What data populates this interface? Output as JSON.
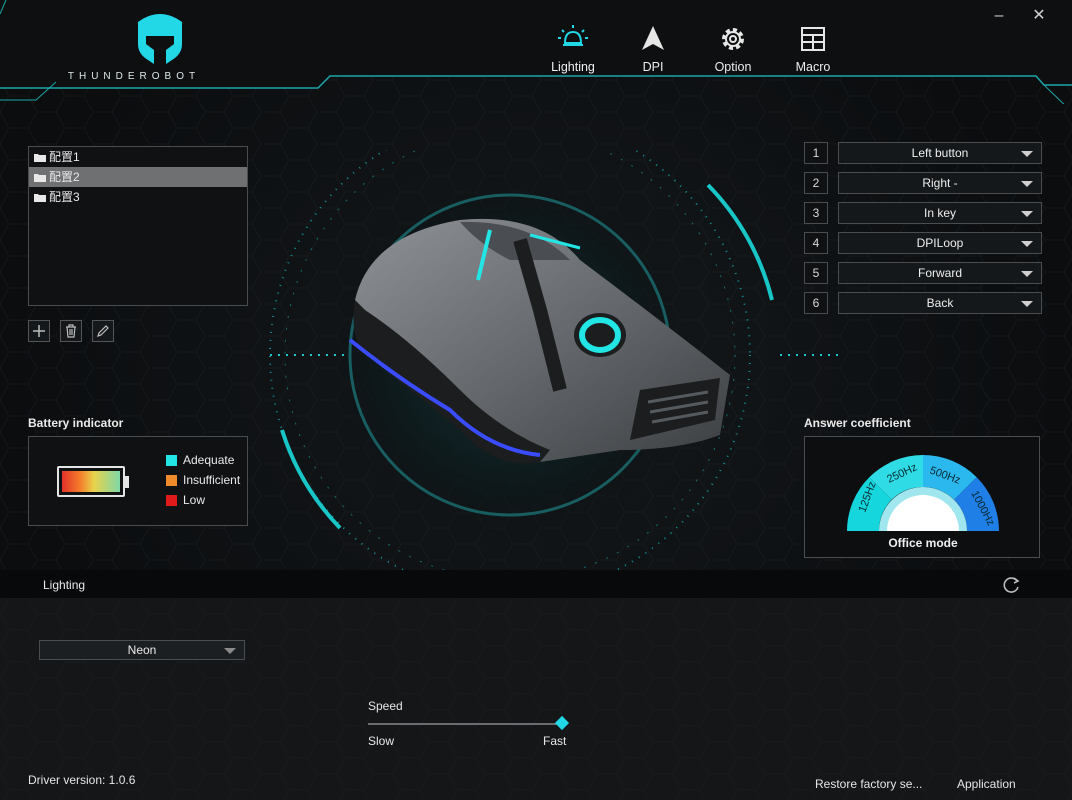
{
  "brand": "THUNDEROBOT",
  "nav": [
    {
      "label": "Lighting",
      "icon": "bulb-icon"
    },
    {
      "label": "DPI",
      "icon": "arrow-icon"
    },
    {
      "label": "Option",
      "icon": "gear-icon"
    },
    {
      "label": "Macro",
      "icon": "grid-icon"
    }
  ],
  "window": {
    "minimize": "–",
    "close": "✕"
  },
  "profiles": {
    "items": [
      "配置1",
      "配置2",
      "配置3"
    ],
    "selected": "配置2"
  },
  "battery": {
    "title": "Battery indicator",
    "legend": [
      {
        "label": "Adequate",
        "color": "#22e6e6"
      },
      {
        "label": "Insufficient",
        "color": "#f08a2a"
      },
      {
        "label": "Low",
        "color": "#e01a1a"
      }
    ]
  },
  "button_map": [
    {
      "num": "1",
      "value": "Left button"
    },
    {
      "num": "2",
      "value": "Right -"
    },
    {
      "num": "3",
      "value": "In key"
    },
    {
      "num": "4",
      "value": "DPILoop"
    },
    {
      "num": "5",
      "value": "Forward"
    },
    {
      "num": "6",
      "value": "Back"
    }
  ],
  "answer": {
    "title": "Answer coefficient",
    "rates": [
      "125Hz",
      "250Hz",
      "500Hz",
      "1000Hz"
    ],
    "mode": "Office mode"
  },
  "lighting": {
    "section": "Lighting",
    "mode": "Neon",
    "speed_label": "Speed",
    "slow": "Slow",
    "fast": "Fast",
    "speed_value": 1.0
  },
  "footer": {
    "driver": "Driver version: 1.0.6",
    "restore": "Restore factory se...",
    "apply": "Application"
  },
  "colors": {
    "accent": "#22d8e6",
    "glow_blue": "#3a4cff"
  }
}
